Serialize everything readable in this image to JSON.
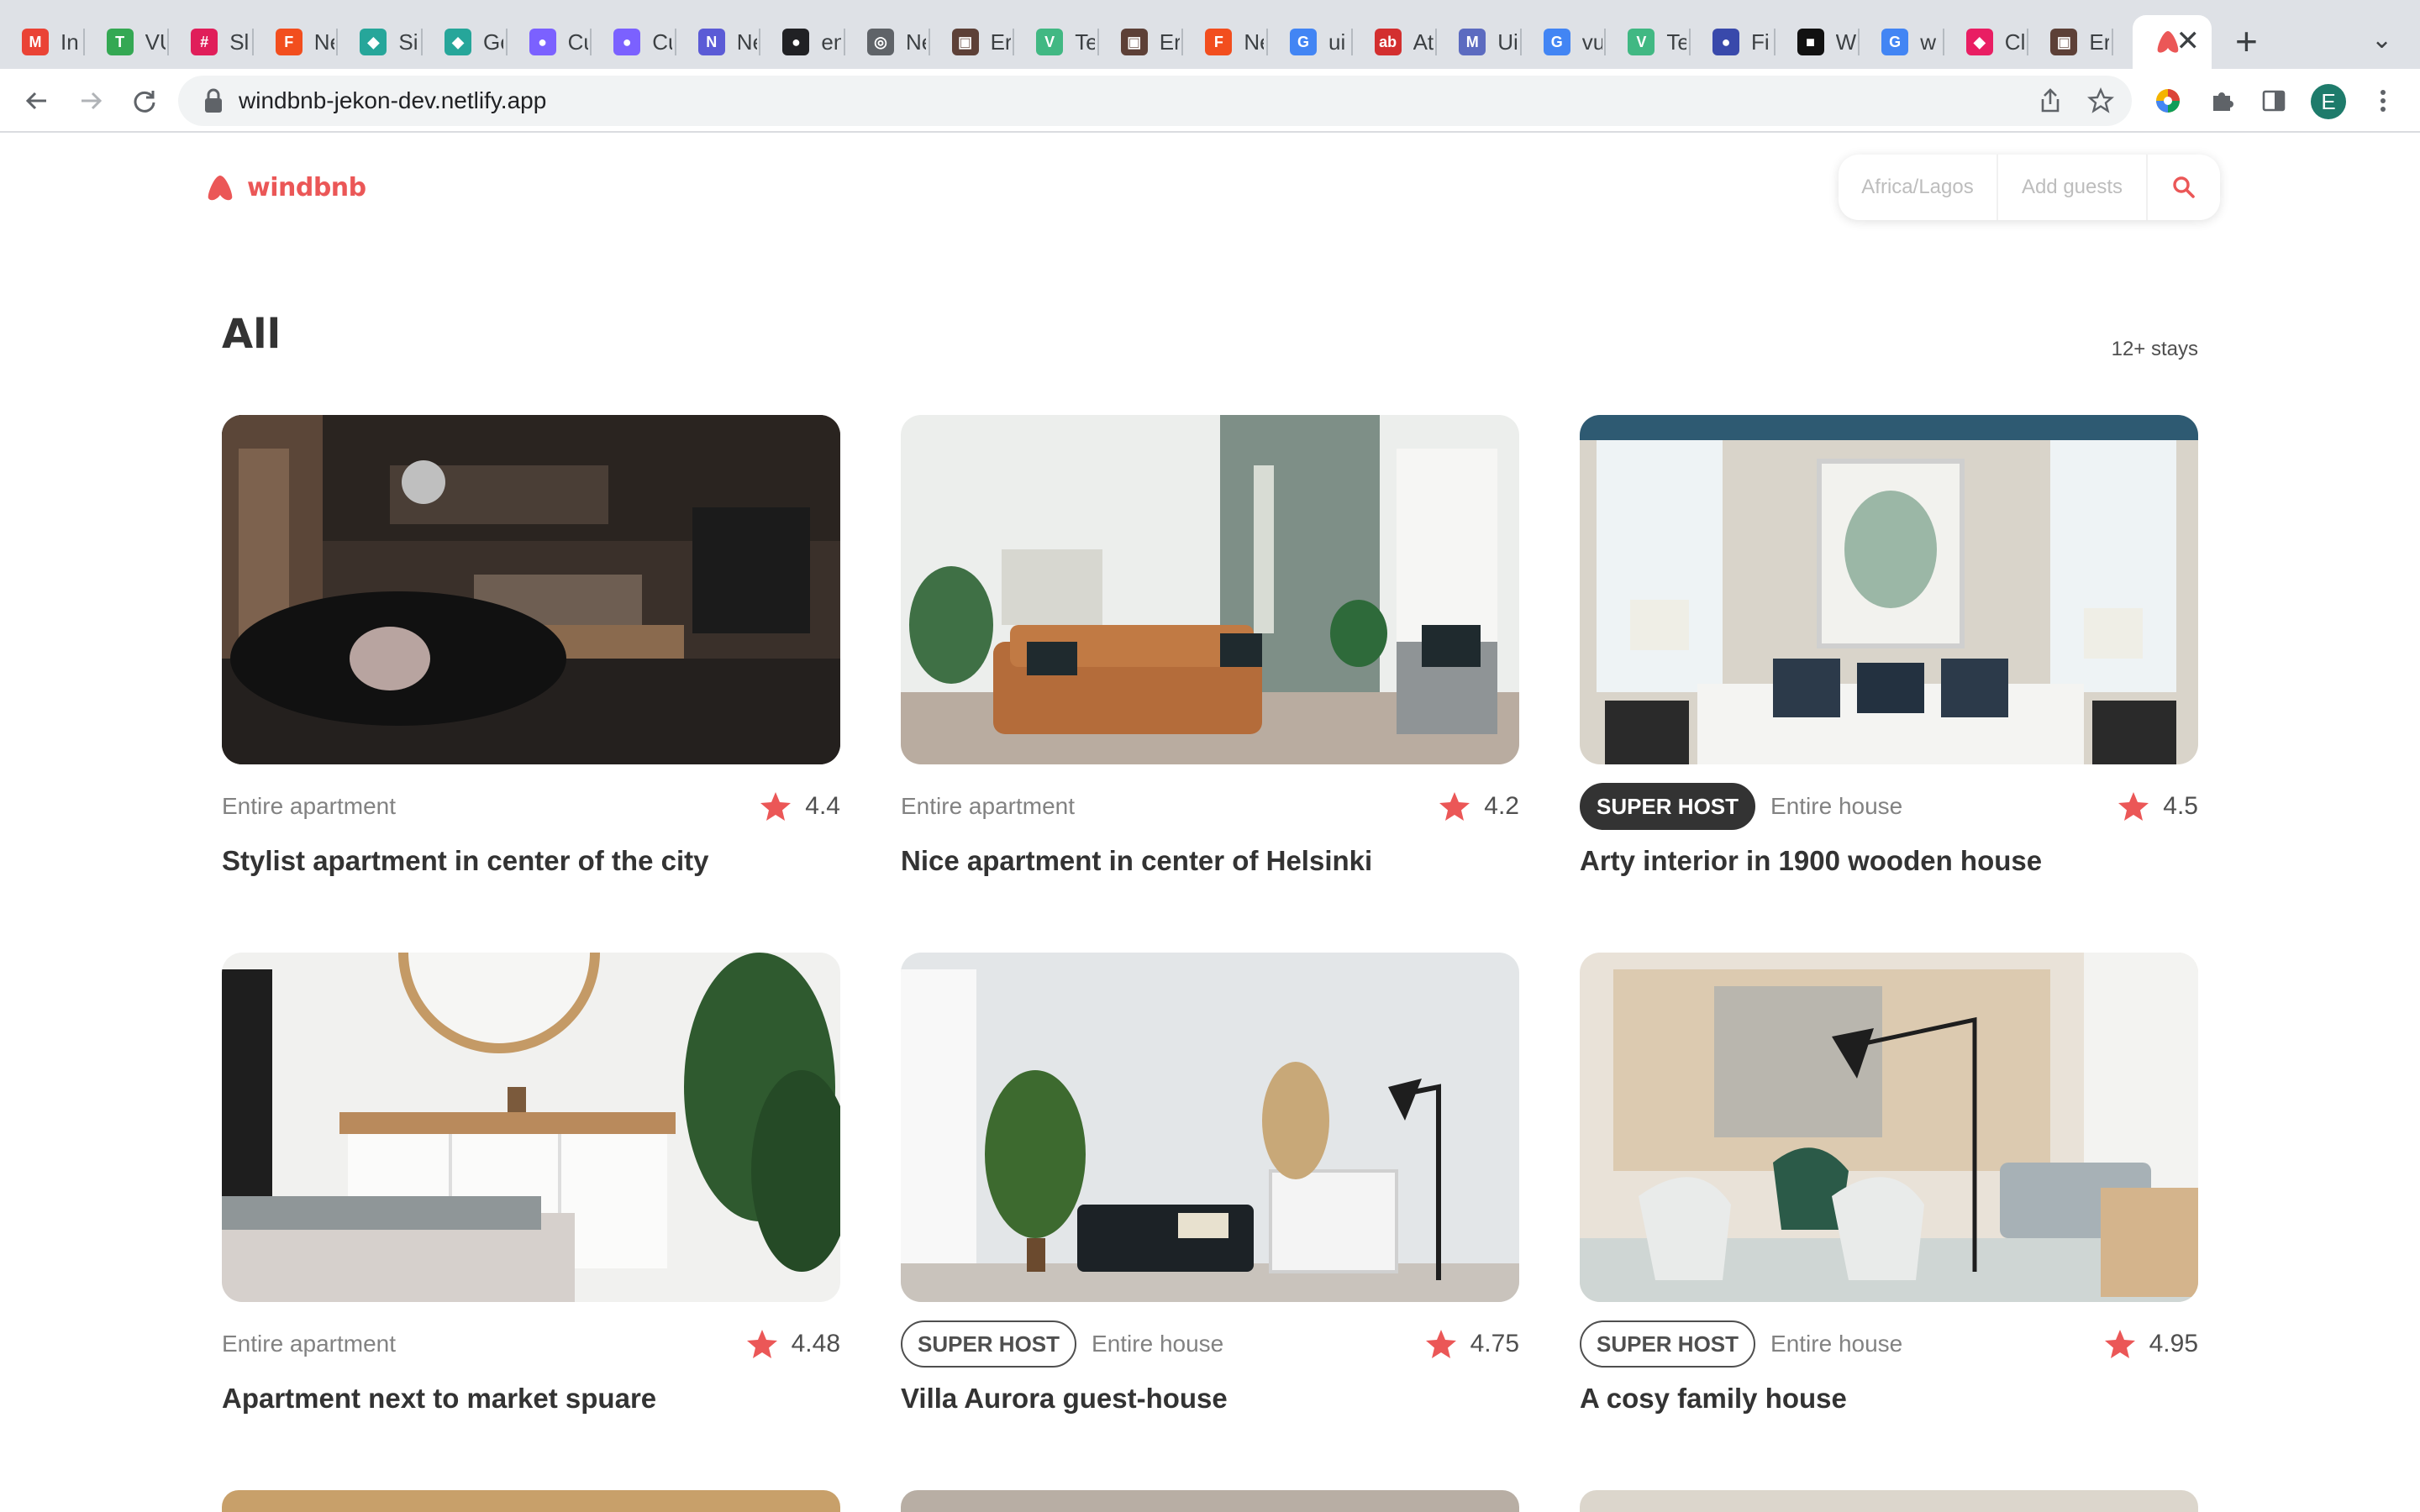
{
  "browser": {
    "tabs": [
      {
        "label": "In",
        "icon": "gmail-icon",
        "color": "#ea4335",
        "glyph": "M"
      },
      {
        "label": "VU",
        "icon": "green-blocks-icon",
        "color": "#34a853",
        "glyph": "T"
      },
      {
        "label": "Sl",
        "icon": "slack-icon",
        "color": "#e01e5a",
        "glyph": "#"
      },
      {
        "label": "Ne",
        "icon": "figma-icon",
        "color": "#f24e1e",
        "glyph": "F"
      },
      {
        "label": "Si",
        "icon": "diamond-icon",
        "color": "#26a69a",
        "glyph": "◆"
      },
      {
        "label": "Ge",
        "icon": "diamond-icon",
        "color": "#26a69a",
        "glyph": "◆"
      },
      {
        "label": "Cu",
        "icon": "purple-blob-icon",
        "color": "#7b61ff",
        "glyph": "●"
      },
      {
        "label": "Cu",
        "icon": "purple-blob-icon",
        "color": "#7b61ff",
        "glyph": "●"
      },
      {
        "label": "Ne",
        "icon": "notion-icon",
        "color": "#5b5bd6",
        "glyph": "N"
      },
      {
        "label": "en",
        "icon": "github-icon",
        "color": "#202124",
        "glyph": "●"
      },
      {
        "label": "Ne",
        "icon": "globe-icon",
        "color": "#5f6368",
        "glyph": "◎"
      },
      {
        "label": "Er",
        "icon": "avatar-icon",
        "color": "#5d4037",
        "glyph": "▣"
      },
      {
        "label": "Te",
        "icon": "vue-icon",
        "color": "#41b883",
        "glyph": "V"
      },
      {
        "label": "Er",
        "icon": "avatar-icon",
        "color": "#5d4037",
        "glyph": "▣"
      },
      {
        "label": "Ne",
        "icon": "figma-icon",
        "color": "#f24e1e",
        "glyph": "F"
      },
      {
        "label": "ui",
        "icon": "google-icon",
        "color": "#4285f4",
        "glyph": "G"
      },
      {
        "label": "At",
        "icon": "ab-icon",
        "color": "#d32f2f",
        "glyph": "ab"
      },
      {
        "label": "Ui",
        "icon": "m-icon",
        "color": "#5c6bc0",
        "glyph": "M"
      },
      {
        "label": "vu",
        "icon": "google-icon",
        "color": "#4285f4",
        "glyph": "G"
      },
      {
        "label": "Te",
        "icon": "vue-icon",
        "color": "#41b883",
        "glyph": "V"
      },
      {
        "label": "Fi",
        "icon": "dot-icon",
        "color": "#3949ab",
        "glyph": "●"
      },
      {
        "label": "W",
        "icon": "black-shape-icon",
        "color": "#111111",
        "glyph": "■"
      },
      {
        "label": "w",
        "icon": "google-icon",
        "color": "#4285f4",
        "glyph": "G"
      },
      {
        "label": "Cl",
        "icon": "droplet-icon",
        "color": "#e91e63",
        "glyph": "◆"
      },
      {
        "label": "Er",
        "icon": "avatar-icon",
        "color": "#5d4037",
        "glyph": "▣"
      }
    ],
    "active_tab": {
      "icon": "windbnb-logo-icon"
    },
    "url": "windbnb-jekon-dev.netlify.app",
    "profile_initial": "E"
  },
  "app": {
    "brand": "windbnb",
    "brand_color": "#eb5757",
    "search": {
      "location": "Africa/Lagos",
      "guests": "Add guests"
    },
    "heading": "All",
    "stay_count": "12+ stays",
    "stays": [
      {
        "type": "Entire apartment",
        "rating": "4.4",
        "title": "Stylist apartment in center of the city",
        "superhost": false
      },
      {
        "type": "Entire apartment",
        "rating": "4.2",
        "title": "Nice apartment in center of Helsinki",
        "superhost": false
      },
      {
        "type": "Entire house",
        "rating": "4.5",
        "title": "Arty interior in 1900 wooden house",
        "superhost": true,
        "superhost_label": "SUPER HOST"
      },
      {
        "type": "Entire apartment",
        "rating": "4.48",
        "title": "Apartment next to market spuare",
        "superhost": false
      },
      {
        "type": "Entire house",
        "rating": "4.75",
        "title": "Villa Aurora guest-house",
        "superhost": true,
        "superhost_label": "SUPER HOST"
      },
      {
        "type": "Entire house",
        "rating": "4.95",
        "title": "A cosy family house",
        "superhost": true,
        "superhost_label": "SUPER HOST"
      }
    ]
  }
}
